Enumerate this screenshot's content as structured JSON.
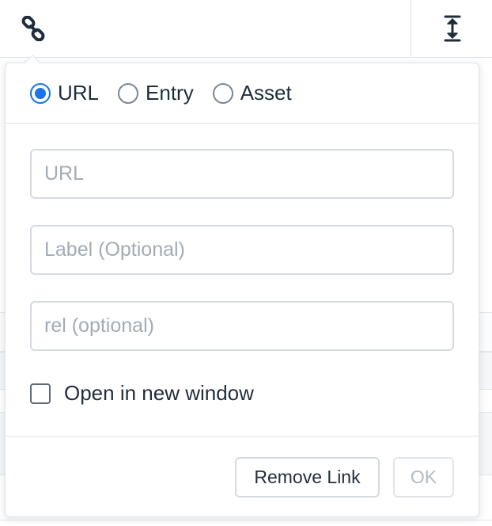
{
  "toolbar": {
    "link_icon": "link-icon",
    "height_icon": "vertical-resize-icon"
  },
  "link_popover": {
    "link_types": [
      {
        "label": "URL",
        "checked": true
      },
      {
        "label": "Entry",
        "checked": false
      },
      {
        "label": "Asset",
        "checked": false
      }
    ],
    "url_field": {
      "value": "",
      "placeholder": "URL"
    },
    "label_field": {
      "value": "",
      "placeholder": "Label (Optional)"
    },
    "rel_field": {
      "value": "",
      "placeholder": "rel (optional)"
    },
    "new_window": {
      "label": "Open in new window",
      "checked": false
    },
    "remove_label": "Remove Link",
    "ok_label": "OK",
    "ok_disabled": true
  },
  "colors": {
    "accent": "#1a73e8",
    "border": "#dfe3e8",
    "text": "#1f2d3d",
    "placeholder": "#a2abb6"
  }
}
